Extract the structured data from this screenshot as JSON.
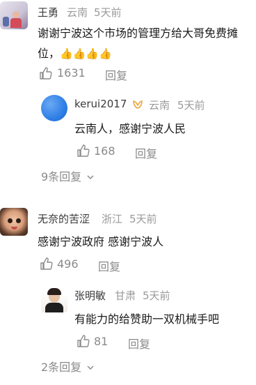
{
  "comments": [
    {
      "author": "王勇",
      "location": "云南",
      "time": "5天前",
      "text_line1": "谢谢宁波这个市场的管理方给大哥免费摊",
      "text_line2": "位，",
      "emojis": "👍👍👍👍",
      "likes": "1631",
      "reply_label": "回复",
      "replies_more": "9条回复",
      "reply": {
        "author": "kerui2017",
        "location": "云南",
        "time": "5天前",
        "text": "云南人，感谢宁波人民",
        "likes": "168",
        "reply_label": "回复"
      }
    },
    {
      "author": "无奈的苦涩",
      "location": "浙江",
      "time": "5天前",
      "text": "感谢宁波政府 感谢宁波人",
      "likes": "496",
      "reply_label": "回复",
      "replies_more": "2条回复",
      "reply": {
        "author": "张明敏",
        "location": "甘肃",
        "time": "5天前",
        "text": "有能力的给赞助一双机械手吧",
        "likes": "81",
        "reply_label": "回复"
      }
    }
  ]
}
